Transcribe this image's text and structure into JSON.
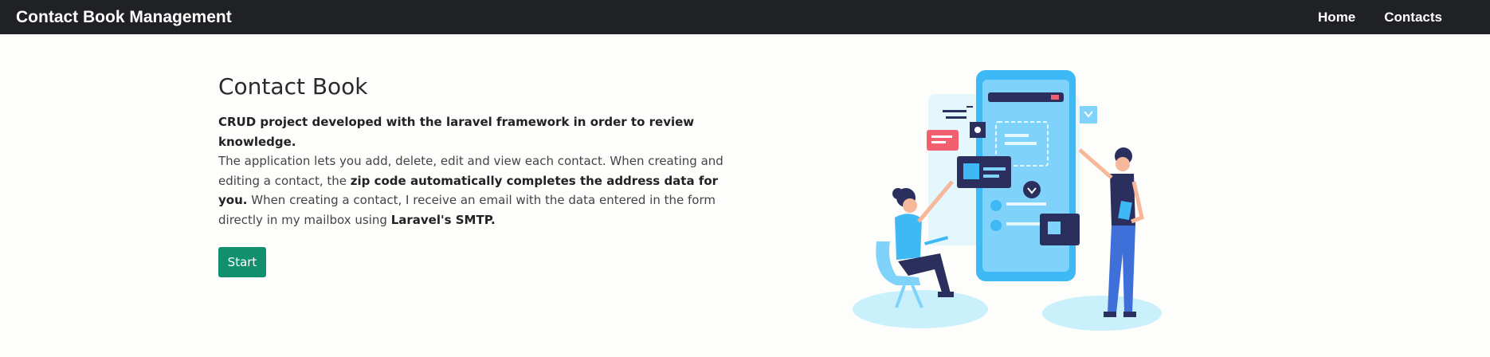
{
  "navbar": {
    "brand": "Contact Book Management",
    "links": [
      {
        "label": "Home"
      },
      {
        "label": "Contacts"
      }
    ]
  },
  "hero": {
    "title": "Contact Book",
    "intro_bold": "CRUD project developed with the laravel framework in order to review knowledge.",
    "text1": "The application lets you add, delete, edit and view each contact. When creating and editing a contact, the ",
    "bold1": "zip code automatically completes the address data for you.",
    "text2": " When creating a contact, I receive an email with the data entered in the form directly in my mailbox using ",
    "bold2": "Laravel's SMTP.",
    "start_label": "Start"
  },
  "colors": {
    "navbar": "#202124",
    "button": "#12906e",
    "illustration_primary": "#3fb9f5",
    "illustration_dark": "#2a2f5e"
  }
}
